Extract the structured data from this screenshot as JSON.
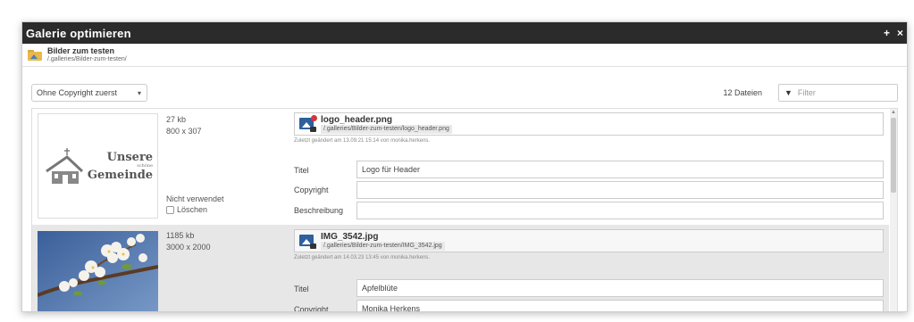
{
  "dialog": {
    "title": "Galerie optimieren",
    "ctrl_add": "+",
    "ctrl_close": "×"
  },
  "folder": {
    "name": "Bilder zum testen",
    "path": "/.galleries/Bilder-zum-testen/"
  },
  "toolbar": {
    "sort_value": "Ohne Copyright zuerst",
    "file_count": "12 Dateien",
    "filter_placeholder": "Filter"
  },
  "labels": {
    "title": "Titel",
    "copyright": "Copyright",
    "description": "Beschreibung"
  },
  "items": [
    {
      "size": "27 kb",
      "dimensions": "800 x 307",
      "usage": "Nicht verwendet",
      "delete_label": "Löschen",
      "filename": "logo_header.png",
      "filepath": "/.galleries/Bilder-zum-testen/logo_header.png",
      "changed": "Zuletzt geändert am 13.09.21 15:14 von monika.herkens.",
      "title": "Logo für Header",
      "copyright": "",
      "description": "",
      "logo": {
        "line1": "Unsere",
        "line2": "schöne",
        "line3": "Gemeinde"
      }
    },
    {
      "size": "1185 kb",
      "dimensions": "3000 x 2000",
      "filename": "IMG_3542.jpg",
      "filepath": "/.galleries/Bilder-zum-testen/IMG_3542.jpg",
      "changed": "Zuletzt geändert am 14.03.23 13:45 von monika.herkens.",
      "title": "Apfelblüte",
      "copyright_partial": "Monika Herkens"
    }
  ]
}
